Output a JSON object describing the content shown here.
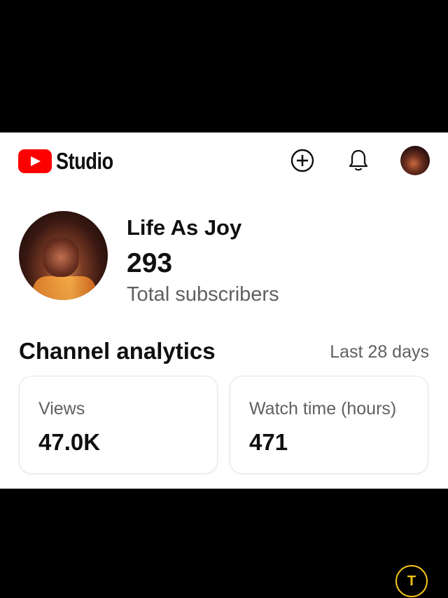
{
  "header": {
    "logo_text": "Studio",
    "icons": [
      "youtube-logo-icon",
      "create-icon",
      "bell-icon",
      "avatar"
    ]
  },
  "channel": {
    "name": "Life As Joy",
    "subscriber_count": "293",
    "subscriber_label": "Total subscribers"
  },
  "analytics": {
    "title": "Channel analytics",
    "period": "Last 28 days",
    "stats": [
      {
        "label": "Views",
        "value": "47.0K"
      },
      {
        "label": "Watch time (hours)",
        "value": "471"
      }
    ]
  },
  "overlay": {
    "translate_glyph": "T"
  },
  "colors": {
    "brand_red": "#ff0000",
    "text_primary": "#0f0f0f",
    "text_secondary": "#606060",
    "overlay_accent": "#f5c518"
  }
}
